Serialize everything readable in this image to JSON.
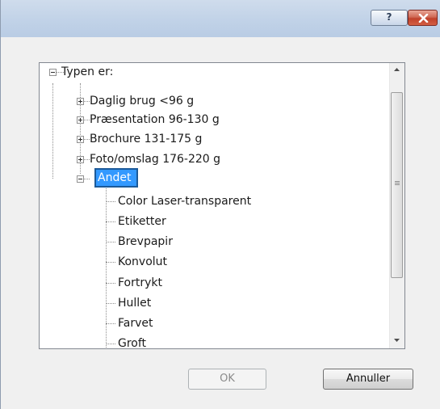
{
  "titlebar": {
    "help_label": "?",
    "close_icon": "close-icon",
    "colors": {
      "close": "#c0412a"
    }
  },
  "tree": {
    "root_label": "Typen er:",
    "groups": [
      {
        "label": "Daglig brug <96 g",
        "state": "collapsed"
      },
      {
        "label": "Præsentation 96-130 g",
        "state": "collapsed"
      },
      {
        "label": "Brochure 131-175 g",
        "state": "collapsed"
      },
      {
        "label": "Foto/omslag 176-220 g",
        "state": "collapsed"
      },
      {
        "label": "Andet",
        "state": "expanded",
        "selected": true
      }
    ],
    "children": [
      "Color Laser-transparent",
      "Etiketter",
      "Brevpapir",
      "Konvolut",
      "Fortrykt",
      "Hullet",
      "Farvet",
      "Groft"
    ]
  },
  "buttons": {
    "ok_label": "OK",
    "cancel_label": "Annuller"
  },
  "colors": {
    "selection": "#3399ff",
    "selection_border": "#1c5a99"
  }
}
